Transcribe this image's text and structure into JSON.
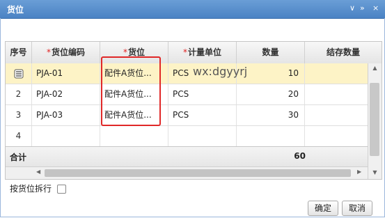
{
  "window": {
    "title": "货位",
    "controls": [
      "∨",
      "»",
      "×"
    ]
  },
  "grid": {
    "columns": [
      {
        "label": "序号",
        "required": false
      },
      {
        "label": "货位编码",
        "required": true
      },
      {
        "label": "货位",
        "required": true
      },
      {
        "label": "计量单位",
        "required": true
      },
      {
        "label": "数量",
        "required": false
      },
      {
        "label": "结存数量",
        "required": false
      }
    ],
    "required_mark": "*",
    "rows": [
      {
        "index": "",
        "code": "PJA-01",
        "location": "配件A货位...",
        "unit": "PCS",
        "qty": "10",
        "balance": "",
        "selected": true
      },
      {
        "index": "2",
        "code": "PJA-02",
        "location": "配件A货位...",
        "unit": "PCS",
        "qty": "20",
        "balance": "",
        "selected": false
      },
      {
        "index": "3",
        "code": "PJA-03",
        "location": "配件A货位...",
        "unit": "PCS",
        "qty": "30",
        "balance": "",
        "selected": false
      },
      {
        "index": "4",
        "code": "",
        "location": "",
        "unit": "",
        "qty": "",
        "balance": "",
        "selected": false
      }
    ],
    "summary": {
      "label": "合计",
      "total_qty": "60"
    }
  },
  "watermark": "wx:dgyyrj",
  "split_checkbox": {
    "label": "按货位拆行",
    "checked": false
  },
  "buttons": {
    "ok": "确定",
    "cancel": "取消"
  },
  "colors": {
    "selected_row": "#fdf3c6",
    "highlight_box": "#e02828",
    "required": "#e02020",
    "titlebar": "#4a82c4"
  }
}
